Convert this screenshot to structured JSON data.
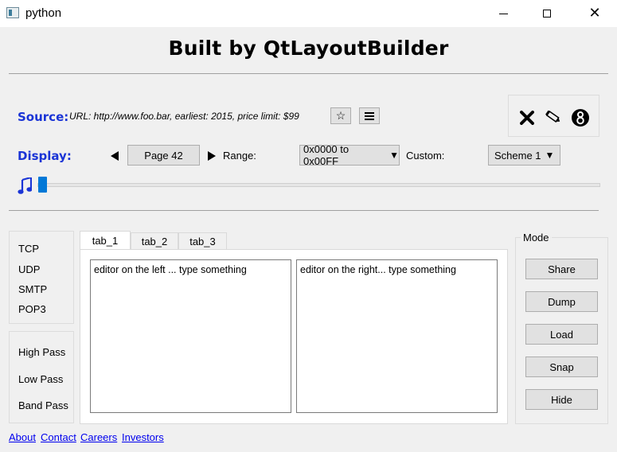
{
  "window": {
    "title": "python"
  },
  "heading": "Built by QtLayoutBuilder",
  "source": {
    "label": "Source:",
    "text": "URL: http://www.foo.bar, earliest: 2015, price limit: $99",
    "star_icon": "star-icon",
    "menu_icon": "menu-icon"
  },
  "toolbox": {
    "icons": [
      "close-x-icon",
      "pencil-icon",
      "eight-ball-icon"
    ]
  },
  "display": {
    "label": "Display:",
    "page_label": "Page 42",
    "range_label": "Range:",
    "range_value": "0x0000 to 0x00FF",
    "custom_label": "Custom:",
    "custom_value": "Scheme 1"
  },
  "slider": {
    "icon": "music-note-icon",
    "value": 0.0
  },
  "protocols": [
    "TCP",
    "UDP",
    "SMTP",
    "POP3"
  ],
  "filters": [
    "High Pass",
    "Low Pass",
    "Band Pass"
  ],
  "tabs": [
    {
      "label": "tab_1",
      "active": true
    },
    {
      "label": "tab_2",
      "active": false
    },
    {
      "label": "tab_3",
      "active": false
    }
  ],
  "editors": {
    "left": "editor on the left ... type something",
    "right": "editor on the right... type something"
  },
  "mode": {
    "title": "Mode",
    "buttons": [
      "Share",
      "Dump",
      "Load",
      "Snap",
      "Hide"
    ]
  },
  "footer_links": [
    "About",
    "Contact",
    "Careers",
    "Investors"
  ],
  "colors": {
    "accent_blue": "#1a34d6",
    "slider": "#0078d7",
    "link": "#0000ee"
  }
}
